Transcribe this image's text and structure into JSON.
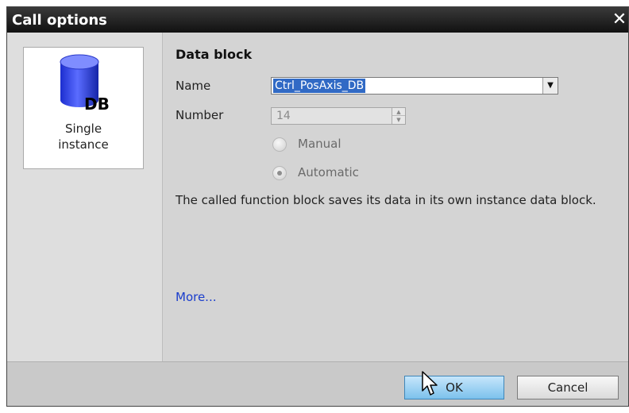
{
  "dialog": {
    "title": "Call options",
    "close_icon": "close-icon"
  },
  "instance_tile": {
    "icon": "database-icon",
    "icon_text": "DB",
    "label_line1": "Single",
    "label_line2": "instance"
  },
  "data_block": {
    "heading": "Data block",
    "name_label": "Name",
    "name_value": "Ctrl_PosAxis_DB",
    "number_label": "Number",
    "number_value": "14",
    "radio_manual_label": "Manual",
    "radio_automatic_label": "Automatic",
    "selected_mode": "Automatic",
    "description": "The called function block saves its data in its own instance data block.",
    "more_link": "More..."
  },
  "footer": {
    "ok_label": "OK",
    "cancel_label": "Cancel"
  },
  "colors": {
    "title_bar": "#111111",
    "selection": "#316ac5",
    "link": "#1a3dcc",
    "ok_button": "#9fd3f4"
  }
}
